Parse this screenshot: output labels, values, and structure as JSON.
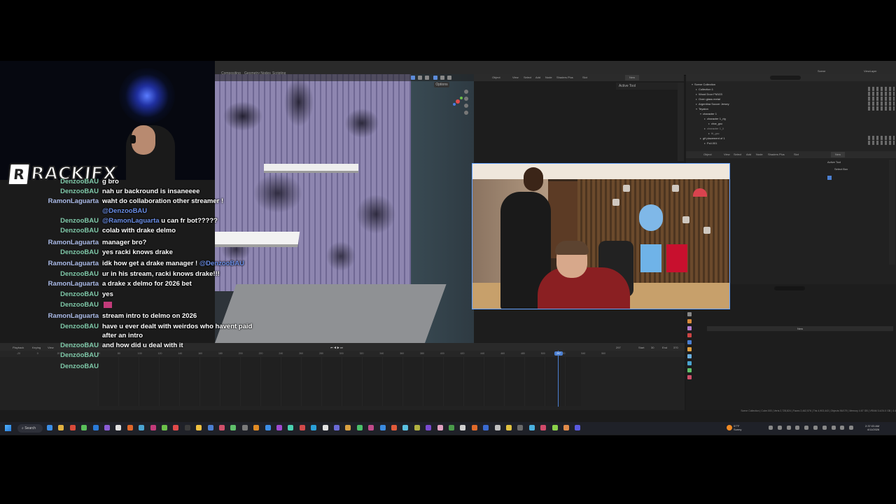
{
  "blender": {
    "workspace_tabs": [
      "Compositing",
      "Geometry Nodes",
      "Scripting"
    ],
    "viewport_options": "Options",
    "node_editor_menu": [
      "Object",
      "View",
      "Select",
      "Add",
      "Node",
      "Shaders Plus",
      "Slot"
    ],
    "node_editor_new": "New",
    "active_tool_label": "Active Tool",
    "outliner": {
      "scene_label": "Scene",
      "view_layer_label": "ViewLayer",
      "rows": [
        "Scene Collection",
        "Collection 1",
        "Wood Door FM103",
        "Oven glass metal",
        "Argentina Soccer Jersey",
        "Teyalon",
        "character 1",
        "character 1_rig",
        "char_gsc",
        "character 1_li",
        "fit_gsc",
        "gif placement of 1",
        "Fs4.001"
      ]
    },
    "properties_menu": [
      "Object",
      "View",
      "Select",
      "Add",
      "Node",
      "Shaders Plus",
      "Slot"
    ],
    "properties_new": "New",
    "properties_active_tool": "Active Tool",
    "properties_select_box": "Select Box",
    "properties_lower_new": "New",
    "timeline": {
      "menus": [
        "Playback",
        "Keying",
        "View"
      ],
      "ticks": [
        "-20",
        "0",
        "20",
        "40",
        "60",
        "80",
        "100",
        "120",
        "140",
        "160",
        "180",
        "200",
        "220",
        "240",
        "260",
        "280",
        "300",
        "320",
        "340",
        "360",
        "380",
        "400",
        "420",
        "440",
        "460",
        "480",
        "500",
        "520",
        "540",
        "560"
      ],
      "current_frame": "297",
      "frame_display": "297",
      "start_label": "Start",
      "start_value": "30",
      "end_label": "End",
      "end_value": "370"
    },
    "status_bar": "Scene Collection | Cube.003 | Verts 2,728,824 | Faces 2,462,576 | Tris 4,903,443 | Objects 56/179 | Memory 4.67 GB | VRAM 3.4/24.0 GB | 4.4"
  },
  "stream": {
    "logo_letter": "R",
    "logo_text": "RACKIFX"
  },
  "chat": {
    "colors": {
      "denzoo": "#7ec8a8",
      "ramon": "#a9b9e6"
    },
    "messages": [
      {
        "user": "DenzooBAU",
        "text": "g bro",
        "cls": "denzoo"
      },
      {
        "user": "DenzooBAU",
        "text": "nah ur backround is insaneeee",
        "cls": "denzoo"
      },
      {
        "user": "RamonLaguarta",
        "text": "waht do collaboration other streamer !",
        "cls": "ramon"
      },
      {
        "user": "",
        "text": "",
        "mention": "@DenzooBAU",
        "cls": "ramon"
      },
      {
        "user": "DenzooBAU",
        "text": " u can fr bot?????",
        "mention": "@RamonLaguarta",
        "cls": "denzoo"
      },
      {
        "user": "DenzooBAU",
        "text": "colab with drake delmo",
        "cls": "denzoo"
      },
      {
        "user": "RamonLaguarta",
        "text": "manager bro?",
        "cls": "ramon"
      },
      {
        "user": "DenzooBAU",
        "text": "yes racki knows drake",
        "cls": "denzoo"
      },
      {
        "user": "RamonLaguarta",
        "text": "idk how get a drake manager ! ",
        "mention_after": "@DenzooBAU",
        "cls": "ramon"
      },
      {
        "user": "DenzooBAU",
        "text": "ur in his stream, racki knows drake!!!",
        "cls": "denzoo"
      },
      {
        "user": "RamonLaguarta",
        "text": "a drake x delmo for 2026 bet",
        "cls": "ramon"
      },
      {
        "user": "DenzooBAU",
        "text": "yes",
        "cls": "denzoo"
      },
      {
        "user": "DenzooBAU",
        "text": "",
        "emote": true,
        "cls": "denzoo"
      },
      {
        "user": "RamonLaguarta",
        "text": "stream intro to delmo on 2026",
        "cls": "ramon"
      },
      {
        "user": "DenzooBAU",
        "text": "have u ever dealt with weirdos who havent paid",
        "cls": "denzoo"
      },
      {
        "user": "",
        "text": "after an intro",
        "cls": "denzoo"
      },
      {
        "user": "DenzooBAU",
        "text": "and how did u deal with it",
        "cls": "denzoo"
      },
      {
        "user": "DenzooBAU",
        "text": "",
        "cls": "denzoo"
      },
      {
        "user": "DenzooBAU",
        "text": "",
        "cls": "denzoo"
      }
    ]
  },
  "taskbar": {
    "search_label": "Search",
    "weather_temp": "57°F",
    "weather_desc": "Sunny",
    "time": "2:37:03 AM",
    "date": "4/11/2026"
  }
}
